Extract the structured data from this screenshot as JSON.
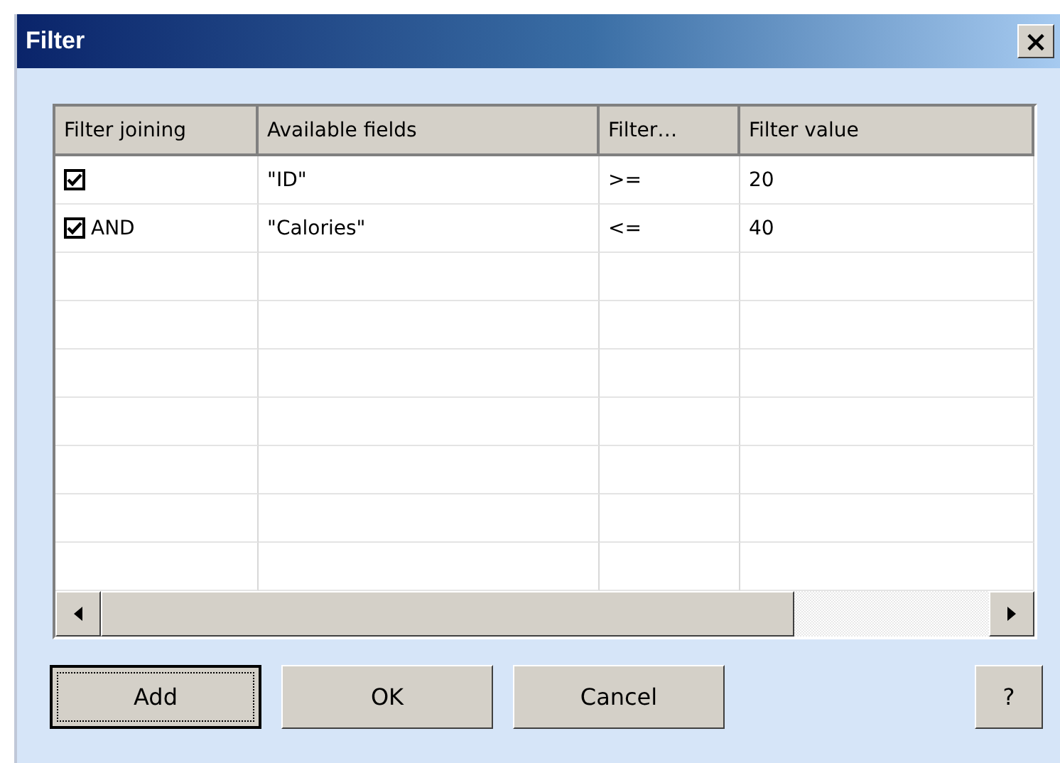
{
  "window": {
    "title": "Filter",
    "close": "×"
  },
  "table": {
    "columns": [
      "Filter joining",
      "Available fields",
      "Filter…",
      "Filter value"
    ],
    "rows": [
      {
        "checked": true,
        "joining": "",
        "field": "\"ID\"",
        "operator": ">=",
        "value": "20"
      },
      {
        "checked": true,
        "joining": "AND",
        "field": "\"Calories\"",
        "operator": "<=",
        "value": "40"
      }
    ]
  },
  "buttons": [
    {
      "label": "Add",
      "focused": true
    },
    {
      "label": "OK",
      "focused": false
    },
    {
      "label": "Cancel",
      "focused": false
    }
  ],
  "help_button": "?"
}
